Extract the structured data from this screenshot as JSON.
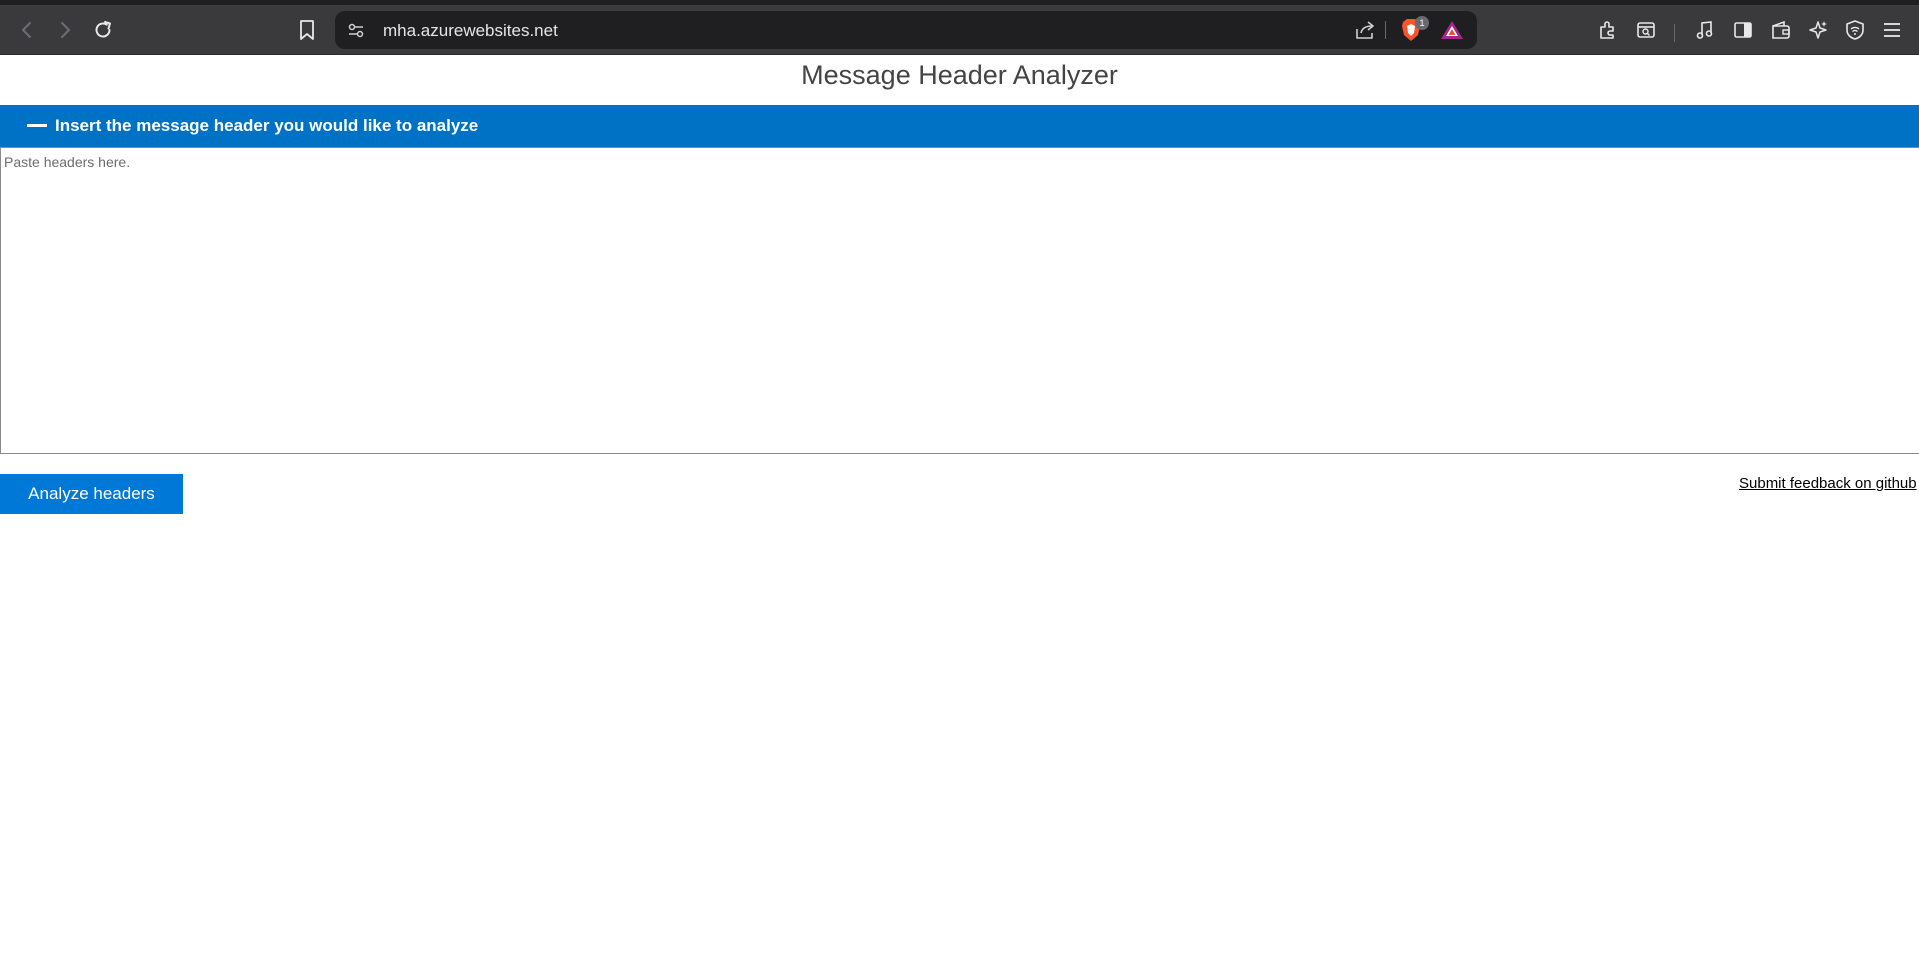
{
  "browser": {
    "url": "mha.azurewebsites.net",
    "shield_count": "1"
  },
  "page": {
    "title": "Message Header Analyzer",
    "section_header": "Insert the message header you would like to analyze",
    "headers_placeholder": "Paste headers here.",
    "headers_value": "",
    "analyze_button": "Analyze headers",
    "feedback_link": "Submit feedback on github"
  },
  "colors": {
    "accent": "#0072c6",
    "button": "#0078d7",
    "chrome_toolbar": "#3a3a3c",
    "address_bar": "#1f1f21"
  },
  "icons": {
    "toolbar_left": [
      "back-icon",
      "forward-icon",
      "reload-icon",
      "bookmark-icon"
    ],
    "address_bar": [
      "site-info-icon",
      "share-icon",
      "brave-shield-icon",
      "brave-rewards-icon"
    ],
    "toolbar_right": [
      "extensions-icon",
      "page-search-icon",
      "media-icon",
      "sidebar-icon",
      "wallet-icon",
      "leo-ai-icon",
      "vpn-icon",
      "menu-icon"
    ]
  }
}
